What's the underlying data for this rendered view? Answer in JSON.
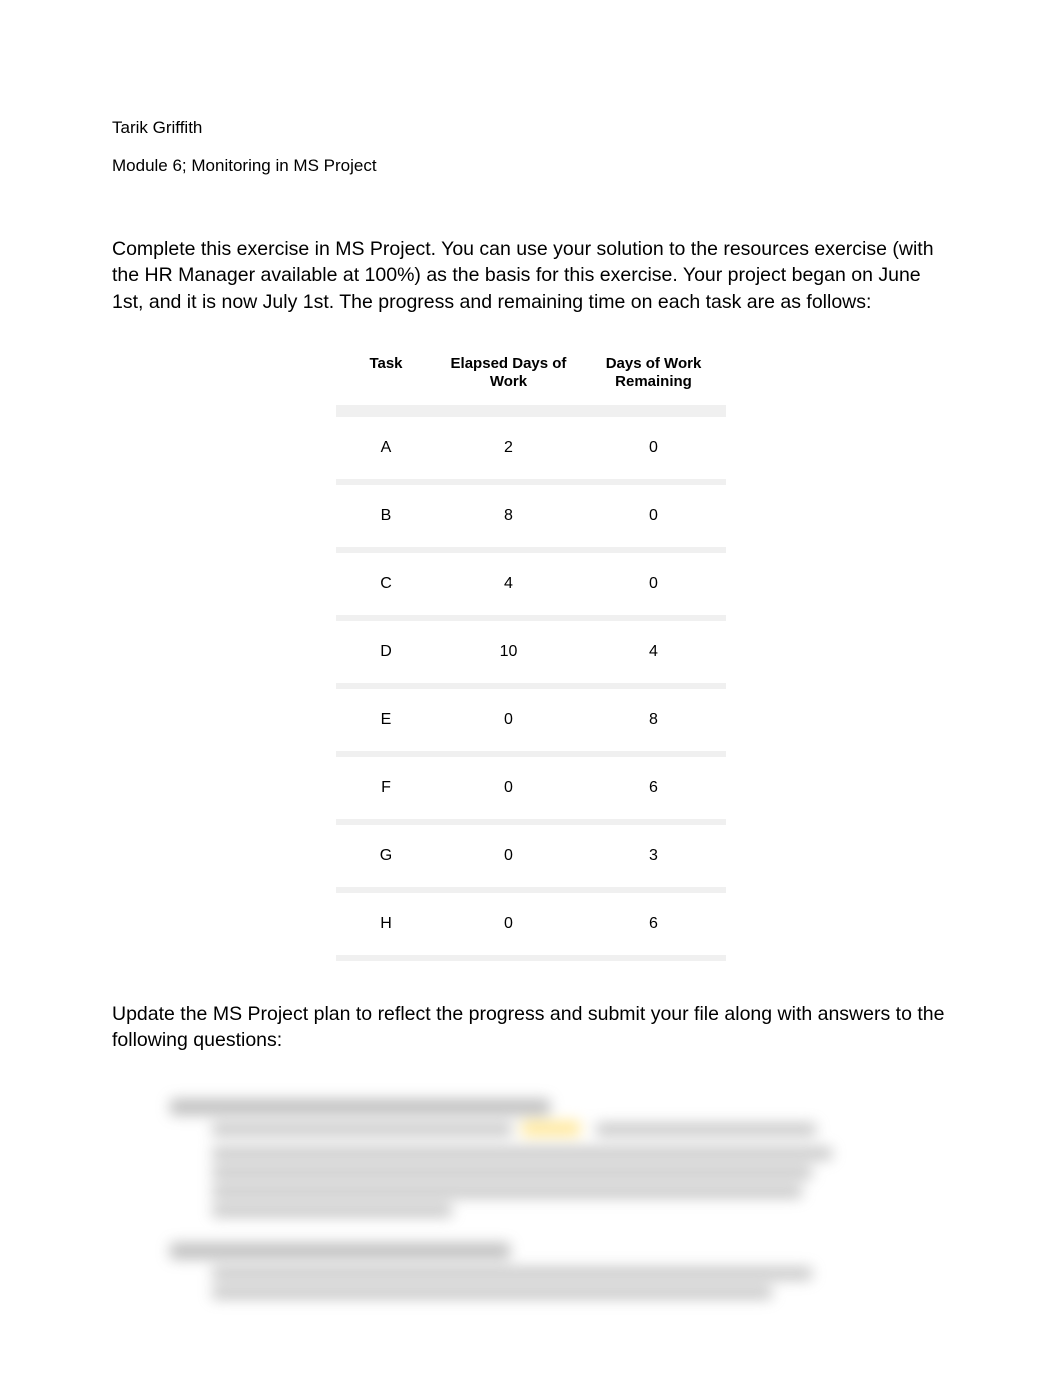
{
  "author": "Tarik Griffith",
  "module_title": "Module 6; Monitoring in MS Project",
  "instructions": "Complete this exercise in MS Project. You can use your solution to the resources exercise (with the HR Manager available at 100%) as the basis for this exercise. Your project began on June 1st, and it is now July 1st. The progress and remaining time on each task are as follows:",
  "table": {
    "headers": {
      "task": "Task",
      "elapsed": "Elapsed Days of Work",
      "remaining": "Days of Work Remaining"
    },
    "rows": [
      {
        "task": "A",
        "elapsed": "2",
        "remaining": "0"
      },
      {
        "task": "B",
        "elapsed": "8",
        "remaining": "0"
      },
      {
        "task": "C",
        "elapsed": "4",
        "remaining": "0"
      },
      {
        "task": "D",
        "elapsed": "10",
        "remaining": "4"
      },
      {
        "task": "E",
        "elapsed": "0",
        "remaining": "8"
      },
      {
        "task": "F",
        "elapsed": "0",
        "remaining": "6"
      },
      {
        "task": "G",
        "elapsed": "0",
        "remaining": "3"
      },
      {
        "task": "H",
        "elapsed": "0",
        "remaining": "6"
      }
    ]
  },
  "update_text": "Update the MS Project plan to reflect the progress and submit your file along with answers to the following questions:"
}
